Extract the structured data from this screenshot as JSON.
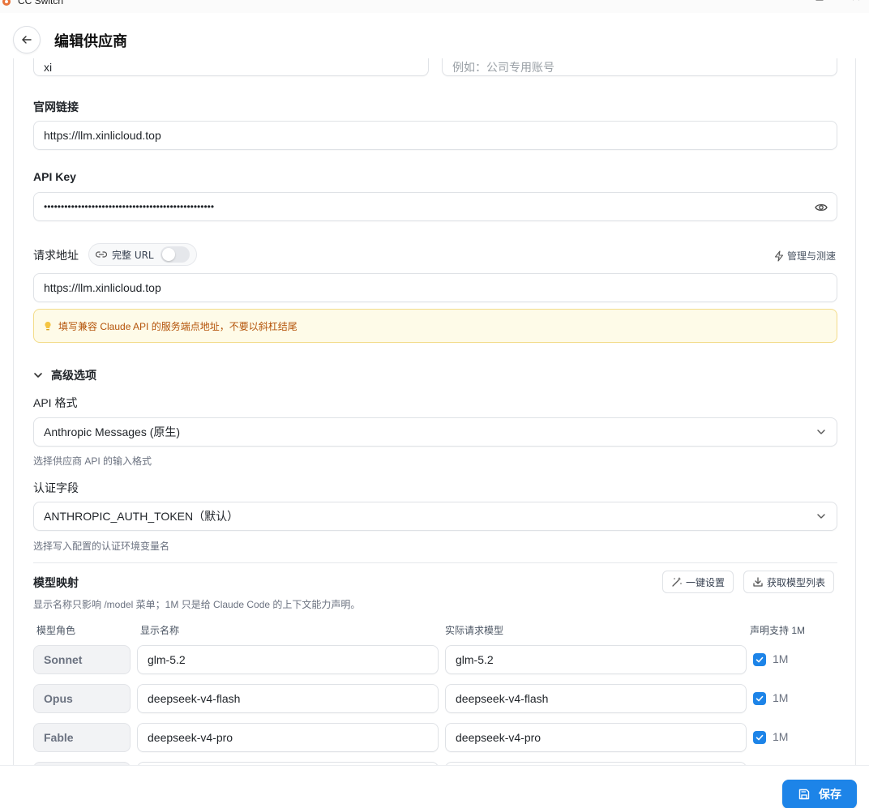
{
  "window": {
    "app_title": "CC Switch"
  },
  "header": {
    "title": "编辑供应商"
  },
  "form": {
    "name_value": "xi",
    "note_placeholder": "例如：公司专用账号",
    "website": {
      "label": "官网链接",
      "value": "https://llm.xinlicloud.top"
    },
    "api_key": {
      "label": "API Key",
      "masked_value": "••••••••••••••••••••••••••••••••••••••••••••••••••"
    },
    "endpoint": {
      "label": "请求地址",
      "full_url_label": "完整 URL",
      "full_url_enabled": false,
      "manage_label": "管理与测速",
      "value": "https://llm.xinlicloud.top",
      "tip": "填写兼容 Claude API 的服务端点地址，不要以斜杠结尾"
    },
    "advanced": {
      "label": "高级选项",
      "api_format": {
        "label": "API 格式",
        "value": "Anthropic Messages (原生)",
        "hint": "选择供应商 API 的输入格式"
      },
      "auth_field": {
        "label": "认证字段",
        "value": "ANTHROPIC_AUTH_TOKEN（默认）",
        "hint": "选择写入配置的认证环境变量名"
      }
    },
    "model_mapping": {
      "label": "模型映射",
      "one_click_label": "一键设置",
      "fetch_label": "获取模型列表",
      "hint": "显示名称只影响 /model 菜单；1M 只是给 Claude Code 的上下文能力声明。",
      "columns": {
        "role": "模型角色",
        "display": "显示名称",
        "actual": "实际请求模型",
        "support": "声明支持 1M"
      },
      "rows": [
        {
          "role": "Sonnet",
          "display": "glm-5.2",
          "actual": "glm-5.2",
          "support_label": "1M",
          "checked": true
        },
        {
          "role": "Opus",
          "display": "deepseek-v4-flash",
          "actual": "deepseek-v4-flash",
          "support_label": "1M",
          "checked": true
        },
        {
          "role": "Fable",
          "display": "deepseek-v4-pro",
          "actual": "deepseek-v4-pro",
          "support_label": "1M",
          "checked": true
        }
      ]
    }
  },
  "footer": {
    "save_label": "保存"
  },
  "colors": {
    "accent": "#1d84e8",
    "tip_bg": "#fefbe8",
    "tip_text": "#b45309"
  }
}
